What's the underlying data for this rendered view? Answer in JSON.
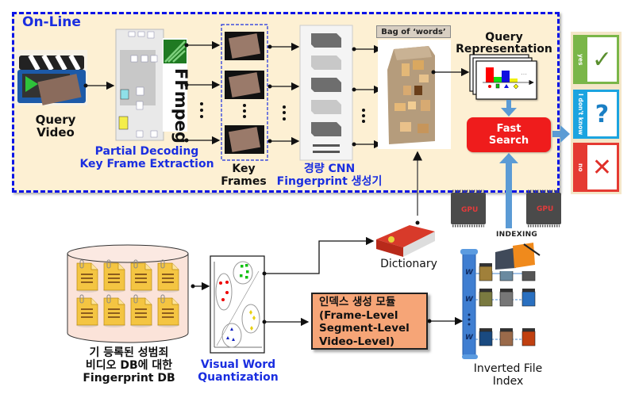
{
  "online": {
    "label": "On-Line",
    "query_video": "Query Video",
    "partial_decoding": [
      "Partial Decoding",
      "Key Frame Extraction"
    ],
    "ffmpeg_label": "FFmpeg",
    "key_frames": [
      "Key",
      "Frames"
    ],
    "cnn": [
      "경량 CNN",
      "Fingerprint 생성기"
    ],
    "bag_of_words": "Bag of ‘words’",
    "query_representation": [
      "Query",
      "Representation"
    ],
    "fast_search": [
      "Fast",
      "Search"
    ]
  },
  "answers": [
    {
      "label": "yes",
      "symbol": "✓",
      "color": "#7ab648",
      "symbol_color": "#5a8f2e"
    },
    {
      "label": "I don't know",
      "symbol": "?",
      "color": "#1ca4e0",
      "symbol_color": "#1a7fc4"
    },
    {
      "label": "no",
      "symbol": "✕",
      "color": "#e53a32",
      "symbol_color": "#e0302a"
    }
  ],
  "offline": {
    "db_caption": [
      "기 등록된 성범죄",
      "비디오 DB에 대한",
      "Fingerprint DB"
    ],
    "vwq_caption": [
      "Visual Word",
      "Quantization"
    ],
    "dictionary": "Dictionary",
    "index_module": [
      "인덱스 생성 모듈",
      "(Frame-Level",
      " Segment-Level",
      " Video-Level)"
    ],
    "gpu_label": "GPU",
    "indexing": "INDEXING",
    "inverted_index": [
      "Inverted File",
      "Index"
    ],
    "word_rows": [
      "W_i",
      "W_j",
      "W_k"
    ]
  },
  "colors": {
    "online_bg": "#fdf0d3",
    "online_border": "#0b14e6",
    "caption_blue": "#1a2ee0",
    "fast_search": "#ef1c1c",
    "index_module": "#f6a577",
    "arrow_blue": "#5b9bd5"
  }
}
